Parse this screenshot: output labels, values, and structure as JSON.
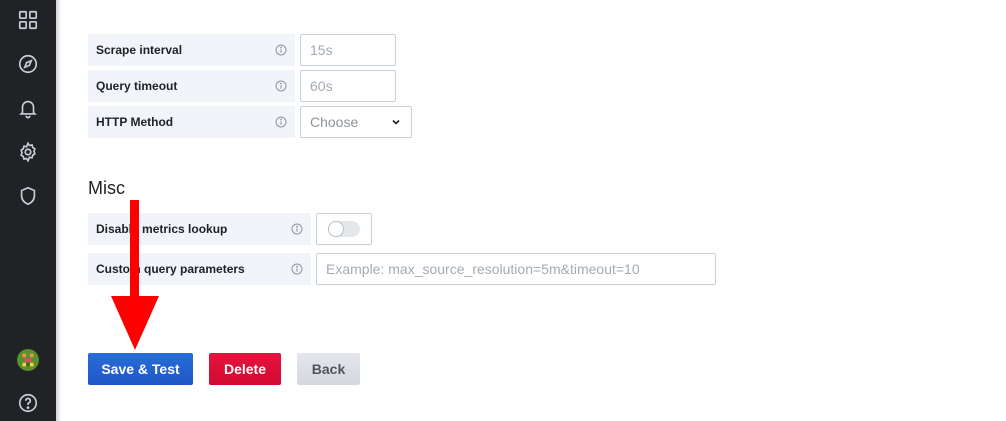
{
  "sidebar": {
    "icons": [
      "dashboards-grid-icon",
      "explore-compass-icon",
      "alerting-bell-icon",
      "configuration-gear-icon",
      "server-admin-shield-icon",
      "user-avatar",
      "help-icon"
    ]
  },
  "http_settings": {
    "scrape_interval": {
      "label": "Scrape interval",
      "placeholder": "15s"
    },
    "query_timeout": {
      "label": "Query timeout",
      "placeholder": "60s"
    },
    "http_method": {
      "label": "HTTP Method",
      "selected": "Choose"
    }
  },
  "misc": {
    "title": "Misc",
    "disable_metrics_lookup": {
      "label": "Disable metrics lookup",
      "value": false
    },
    "custom_query_parameters": {
      "label": "Custom query parameters",
      "placeholder": "Example: max_source_resolution=5m&timeout=10"
    }
  },
  "actions": {
    "save_label": "Save & Test",
    "delete_label": "Delete",
    "back_label": "Back"
  },
  "colors": {
    "sidebar": "#202226",
    "primary": "#1f60c4",
    "danger": "#e0103a",
    "annotation_arrow": "#ff0000"
  }
}
